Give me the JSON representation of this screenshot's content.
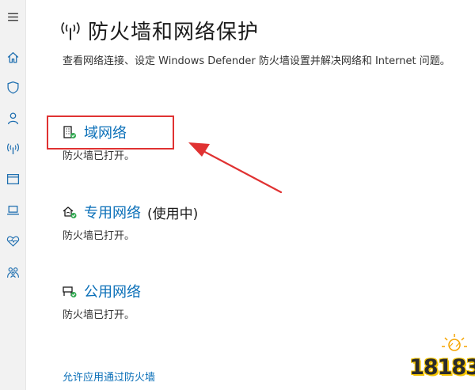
{
  "sidebar": {
    "items": [
      {
        "name": "menu",
        "icon": "hamburger-menu-icon"
      },
      {
        "name": "home",
        "icon": "home-icon"
      },
      {
        "name": "virus-protection",
        "icon": "shield-icon"
      },
      {
        "name": "account-protection",
        "icon": "person-icon"
      },
      {
        "name": "firewall",
        "icon": "wireless-antenna-icon",
        "active": true
      },
      {
        "name": "app-browser-control",
        "icon": "browser-window-icon"
      },
      {
        "name": "device-security",
        "icon": "laptop-icon"
      },
      {
        "name": "device-health",
        "icon": "heart-pulse-icon"
      },
      {
        "name": "family-options",
        "icon": "family-icon"
      }
    ]
  },
  "header": {
    "title": "防火墙和网络保护",
    "icon": "wireless-antenna-icon"
  },
  "description": "查看网络连接、设定 Windows Defender 防火墙设置并解决网络和 Internet 问题。",
  "networks": [
    {
      "label": "域网络",
      "tag": "",
      "status": "防火墙已打开。",
      "icon": "domain-building-icon"
    },
    {
      "label": "专用网络",
      "tag": "(使用中)",
      "status": "防火墙已打开。",
      "icon": "private-network-house-icon"
    },
    {
      "label": "公用网络",
      "tag": "",
      "status": "防火墙已打开。",
      "icon": "public-network-bench-icon"
    }
  ],
  "links": {
    "allow_app": "允许应用通过防火墙"
  },
  "watermark": {
    "text": "18183"
  },
  "colors": {
    "link": "#0a6fb8",
    "annotation_red": "#e03232",
    "status_ok_green": "#2fa84f",
    "sidebar_bg": "#f2f2f2",
    "watermark_yellow": "#f5c400"
  }
}
